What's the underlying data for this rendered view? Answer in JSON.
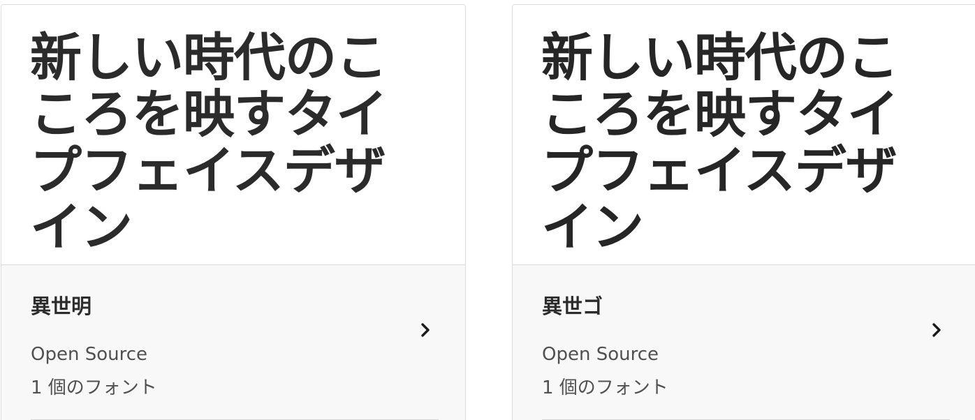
{
  "cards": [
    {
      "preview_text": "新しい時代のこころを映すタイプフェイスデザイン",
      "family_name": "異世明",
      "source": "Open Source",
      "font_count": "1 個のフォント",
      "chevron_icon": "chevron-right-icon"
    },
    {
      "preview_text": "新しい時代のこころを映すタイプフェイスデザイン",
      "family_name": "異世ゴ",
      "source": "Open Source",
      "font_count": "1 個のフォント",
      "chevron_icon": "chevron-right-icon"
    }
  ],
  "colors": {
    "card_border": "#dcdcdc",
    "info_background": "#f8f8f8",
    "preview_text": "#2b2b2b",
    "secondary_text": "#505050"
  }
}
